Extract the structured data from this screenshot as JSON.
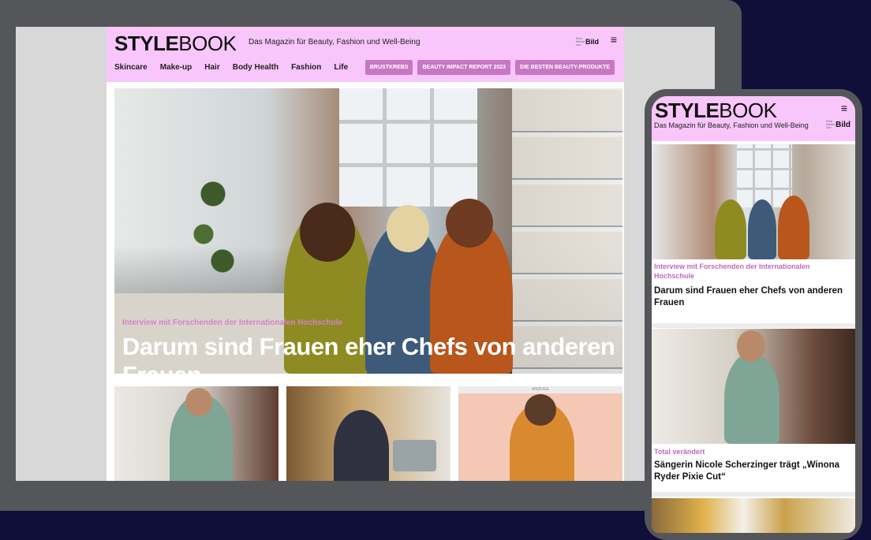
{
  "desktop": {
    "logo": {
      "bold": "STYLE",
      "light": "BOOK"
    },
    "tagline": "Das Magazin für Beauty, Fashion und Well-Being",
    "brand_tiny": "Eine Marke von",
    "brand_name": "Bild",
    "menu_icon": "≡",
    "nav": [
      "Skincare",
      "Make-up",
      "Hair",
      "Body Health",
      "Fashion",
      "Life"
    ],
    "pills": [
      "BRUSTKREBS",
      "BEAUTY IMPACT REPORT 2023",
      "DIE BESTEN BEAUTY-PRODUKTE"
    ],
    "hero": {
      "kicker": "Interview mit Forschenden der Internationalen Hochschule",
      "title": "Darum sind Frauen eher Chefs von anderen Frauen"
    },
    "ad_label": "ANZEIGE"
  },
  "mobile": {
    "logo": {
      "bold": "STYLE",
      "light": "BOOK"
    },
    "tagline": "Das Magazin für Beauty, Fashion und Well-Being",
    "brand_tiny": "Eine Marke von",
    "brand_name": "Bild",
    "menu_icon": "≡",
    "article1": {
      "kicker": "Interview mit Forschenden der Internationalen Hochschule",
      "title": "Darum sind Frauen eher Chefs von anderen Frauen"
    },
    "article2": {
      "kicker": "Total verändert",
      "title": "Sängerin Nicole Scherzinger trägt „Winona Ryder Pixie Cut“"
    }
  },
  "colors": {
    "header_bg": "#f9c6fb",
    "accent": "#c777c3",
    "page_bg": "#0f0f3a",
    "device_frame": "#55565a"
  }
}
